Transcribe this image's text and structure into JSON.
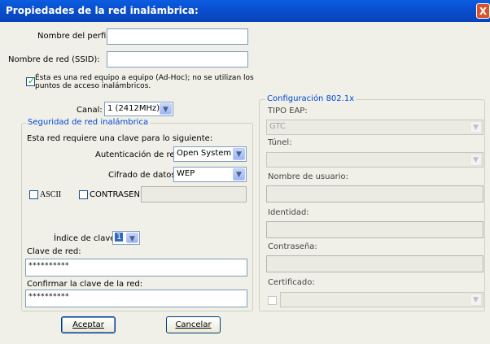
{
  "window": {
    "title": "Propiedades de la red inalámbrica:",
    "close_glyph": "X"
  },
  "profile": {
    "label": "Nombre del perfil:",
    "value": ""
  },
  "ssid": {
    "label": "Nombre de red (SSID):",
    "value": ""
  },
  "adhoc": {
    "label_line1": "Ésta es una red equipo a equipo (Ad-Hoc); no se utilizan los",
    "label_line2": "puntos de acceso inalámbricos.",
    "checked": true
  },
  "channel": {
    "label": "Canal:",
    "value": "1 (2412MHz)"
  },
  "security": {
    "legend": "Seguridad de red inalámbrica",
    "intro": "Esta red requiere una clave para lo siguiente:",
    "auth_label": "Autenticación de red:",
    "auth_value": "Open System",
    "cipher_label": "Cifrado de datos:",
    "cipher_value": "WEP",
    "ascii_label": "ASCII",
    "password_label": "CONTRASEÑA",
    "password_value": "",
    "key_index_label": "Índice de clave",
    "key_index_value": "1",
    "key_label": "Clave de red:",
    "key_value": "**********",
    "confirm_label": "Confirmar la clave de la red:",
    "confirm_value": "**********"
  },
  "eap": {
    "legend": "Configuración 802.1x",
    "type_label": "TIPO EAP:",
    "type_value": "GTC",
    "tunnel_label": "Túnel:",
    "tunnel_value": "",
    "username_label": "Nombre de usuario:",
    "identity_label": "Identidad:",
    "password_label": "Contraseña:",
    "certificate_label": "Certificado:",
    "certificate_value": ""
  },
  "buttons": {
    "ok_label": "Aceptar",
    "cancel_label": "Cancelar"
  },
  "colors": {
    "titlebar": "#0a4fd0",
    "legend": "#0046d5",
    "close": "#d8532c"
  }
}
